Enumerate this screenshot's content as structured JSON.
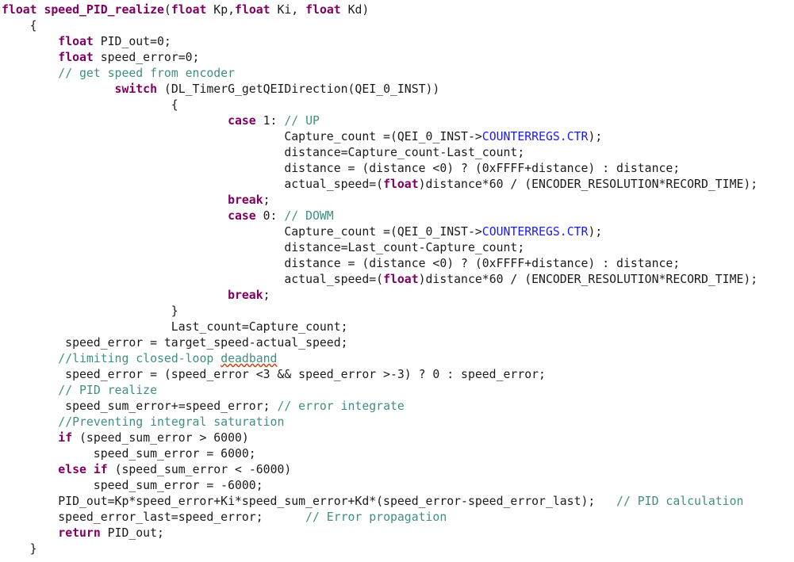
{
  "editor": {
    "language": "c",
    "background_color": "#ffffff",
    "foreground_color": "#1a1a1a",
    "keyword_color": "#800060",
    "comment_color": "#3f8f7f",
    "member_color": "#1a1aff",
    "spellcheck_underline_color": "#d04010",
    "function_name": "speed_PID_realize"
  },
  "code": {
    "lines": [
      {
        "indent": 0,
        "tokens": [
          {
            "t": "kw",
            "s": "float"
          },
          {
            "t": "plain",
            "s": " "
          },
          {
            "t": "kw",
            "s": "speed_PID_realize"
          },
          {
            "t": "plain",
            "s": "("
          },
          {
            "t": "kw",
            "s": "float"
          },
          {
            "t": "plain",
            "s": " Kp,"
          },
          {
            "t": "kw",
            "s": "float"
          },
          {
            "t": "plain",
            "s": " Ki, "
          },
          {
            "t": "kw",
            "s": "float"
          },
          {
            "t": "plain",
            "s": " Kd)"
          }
        ]
      },
      {
        "indent": 0,
        "tokens": [
          {
            "t": "plain",
            "s": "    {"
          }
        ]
      },
      {
        "indent": 0,
        "tokens": [
          {
            "t": "plain",
            "s": "        "
          },
          {
            "t": "kw",
            "s": "float"
          },
          {
            "t": "plain",
            "s": " PID_out=0;"
          }
        ]
      },
      {
        "indent": 0,
        "tokens": [
          {
            "t": "plain",
            "s": "        "
          },
          {
            "t": "kw",
            "s": "float"
          },
          {
            "t": "plain",
            "s": " speed_error=0;"
          }
        ]
      },
      {
        "indent": 0,
        "tokens": [
          {
            "t": "plain",
            "s": "        "
          },
          {
            "t": "comment",
            "s": "// get speed from encoder"
          }
        ]
      },
      {
        "indent": 0,
        "tokens": [
          {
            "t": "plain",
            "s": "                "
          },
          {
            "t": "kw",
            "s": "switch"
          },
          {
            "t": "plain",
            "s": " (DL_TimerG_getQEIDirection(QEI_0_INST))"
          }
        ]
      },
      {
        "indent": 0,
        "tokens": [
          {
            "t": "plain",
            "s": "                        {"
          }
        ]
      },
      {
        "indent": 0,
        "tokens": [
          {
            "t": "plain",
            "s": "                                "
          },
          {
            "t": "kw",
            "s": "case"
          },
          {
            "t": "plain",
            "s": " 1: "
          },
          {
            "t": "comment",
            "s": "// UP"
          }
        ]
      },
      {
        "indent": 0,
        "tokens": [
          {
            "t": "plain",
            "s": "                                        Capture_count =(QEI_0_INST->"
          },
          {
            "t": "member",
            "s": "COUNTERREGS"
          },
          {
            "t": "member",
            "s": "."
          },
          {
            "t": "member",
            "s": "CTR"
          },
          {
            "t": "plain",
            "s": ");"
          }
        ]
      },
      {
        "indent": 0,
        "tokens": [
          {
            "t": "plain",
            "s": "                                        distance=Capture_count-Last_count;"
          }
        ]
      },
      {
        "indent": 0,
        "tokens": [
          {
            "t": "plain",
            "s": "                                        distance = (distance <0) ? (0xFFFF+distance) : distance;"
          }
        ]
      },
      {
        "indent": 0,
        "tokens": [
          {
            "t": "plain",
            "s": "                                        actual_speed=("
          },
          {
            "t": "kw",
            "s": "float"
          },
          {
            "t": "plain",
            "s": ")distance*60 / (ENCODER_RESOLUTION*RECORD_TIME);"
          }
        ]
      },
      {
        "indent": 0,
        "tokens": [
          {
            "t": "plain",
            "s": "                                "
          },
          {
            "t": "kw",
            "s": "break"
          },
          {
            "t": "plain",
            "s": ";"
          }
        ]
      },
      {
        "indent": 0,
        "tokens": [
          {
            "t": "plain",
            "s": "                                "
          },
          {
            "t": "kw",
            "s": "case"
          },
          {
            "t": "plain",
            "s": " 0: "
          },
          {
            "t": "comment",
            "s": "// DOWM"
          }
        ]
      },
      {
        "indent": 0,
        "tokens": [
          {
            "t": "plain",
            "s": "                                        Capture_count =(QEI_0_INST->"
          },
          {
            "t": "member",
            "s": "COUNTERREGS"
          },
          {
            "t": "member",
            "s": "."
          },
          {
            "t": "member",
            "s": "CTR"
          },
          {
            "t": "plain",
            "s": ");"
          }
        ]
      },
      {
        "indent": 0,
        "tokens": [
          {
            "t": "plain",
            "s": "                                        distance=Last_count-Capture_count;"
          }
        ]
      },
      {
        "indent": 0,
        "tokens": [
          {
            "t": "plain",
            "s": "                                        distance = (distance <0) ? (0xFFFF+distance) : distance;"
          }
        ]
      },
      {
        "indent": 0,
        "tokens": [
          {
            "t": "plain",
            "s": "                                        actual_speed=("
          },
          {
            "t": "kw",
            "s": "float"
          },
          {
            "t": "plain",
            "s": ")distance*60 / (ENCODER_RESOLUTION*RECORD_TIME);"
          }
        ]
      },
      {
        "indent": 0,
        "tokens": [
          {
            "t": "plain",
            "s": "                                "
          },
          {
            "t": "kw",
            "s": "break"
          },
          {
            "t": "plain",
            "s": ";"
          }
        ]
      },
      {
        "indent": 0,
        "tokens": [
          {
            "t": "plain",
            "s": "                        }"
          }
        ]
      },
      {
        "indent": 0,
        "tokens": [
          {
            "t": "plain",
            "s": "                        Last_count=Capture_count;"
          }
        ]
      },
      {
        "indent": 0,
        "tokens": [
          {
            "t": "plain",
            "s": "         speed_error = target_speed-actual_speed;"
          }
        ]
      },
      {
        "indent": 0,
        "tokens": [
          {
            "t": "plain",
            "s": "        "
          },
          {
            "t": "comment",
            "s": "//limiting closed-loop "
          },
          {
            "t": "spell",
            "s": "deadband"
          }
        ]
      },
      {
        "indent": 0,
        "tokens": [
          {
            "t": "plain",
            "s": "         speed_error = (speed_error <3 && speed_error >-3) ? 0 : speed_error;"
          }
        ]
      },
      {
        "indent": 0,
        "tokens": [
          {
            "t": "plain",
            "s": "        "
          },
          {
            "t": "comment",
            "s": "// PID realize"
          }
        ]
      },
      {
        "indent": 0,
        "tokens": [
          {
            "t": "plain",
            "s": "         speed_sum_error+=speed_error; "
          },
          {
            "t": "comment",
            "s": "// error integrate"
          }
        ]
      },
      {
        "indent": 0,
        "tokens": [
          {
            "t": "plain",
            "s": "        "
          },
          {
            "t": "comment",
            "s": "//Preventing integral saturation"
          }
        ]
      },
      {
        "indent": 0,
        "tokens": [
          {
            "t": "plain",
            "s": "        "
          },
          {
            "t": "kw",
            "s": "if"
          },
          {
            "t": "plain",
            "s": " (speed_sum_error > 6000)"
          }
        ]
      },
      {
        "indent": 0,
        "tokens": [
          {
            "t": "plain",
            "s": "             speed_sum_error = 6000;"
          }
        ]
      },
      {
        "indent": 0,
        "tokens": [
          {
            "t": "plain",
            "s": "        "
          },
          {
            "t": "kw",
            "s": "else"
          },
          {
            "t": "plain",
            "s": " "
          },
          {
            "t": "kw",
            "s": "if"
          },
          {
            "t": "plain",
            "s": " (speed_sum_error < -6000)"
          }
        ]
      },
      {
        "indent": 0,
        "tokens": [
          {
            "t": "plain",
            "s": "             speed_sum_error = -6000;"
          }
        ]
      },
      {
        "indent": 0,
        "tokens": [
          {
            "t": "plain",
            "s": "        PID_out=Kp*speed_error+Ki*speed_sum_error+Kd*(speed_error-speed_error_last);   "
          },
          {
            "t": "comment",
            "s": "// PID calculation"
          }
        ]
      },
      {
        "indent": 0,
        "tokens": [
          {
            "t": "plain",
            "s": "        speed_error_last=speed_error;      "
          },
          {
            "t": "comment",
            "s": "// Error propagation"
          }
        ]
      },
      {
        "indent": 0,
        "tokens": [
          {
            "t": "plain",
            "s": "        "
          },
          {
            "t": "kw",
            "s": "return"
          },
          {
            "t": "plain",
            "s": " PID_out;"
          }
        ]
      },
      {
        "indent": 0,
        "tokens": [
          {
            "t": "plain",
            "s": "    }"
          }
        ]
      }
    ]
  }
}
